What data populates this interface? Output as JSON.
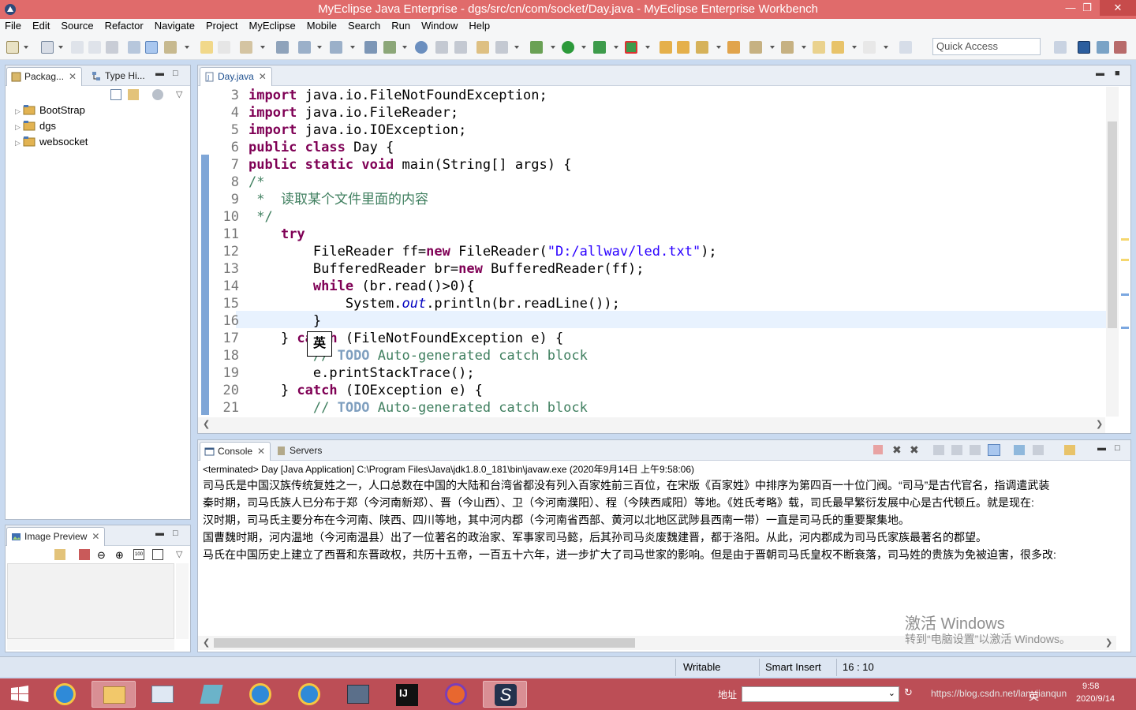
{
  "window": {
    "title": "MyEclipse Java Enterprise - dgs/src/cn/com/socket/Day.java - MyEclipse Enterprise Workbench",
    "min": "—",
    "restore": "❐",
    "close": "✕"
  },
  "menu": [
    "File",
    "Edit",
    "Source",
    "Refactor",
    "Navigate",
    "Project",
    "MyEclipse",
    "Mobile",
    "Search",
    "Run",
    "Window",
    "Help"
  ],
  "quick_access": {
    "placeholder": "Quick Access"
  },
  "explorer": {
    "tabs": [
      "Packag...",
      "Type Hi..."
    ],
    "items": [
      "BootStrap",
      "dgs",
      "websocket"
    ]
  },
  "image_preview": {
    "tab": "Image Preview"
  },
  "editor": {
    "tab": "Day.java",
    "lines": [
      {
        "n": "3",
        "t": [
          [
            "kw",
            "import"
          ],
          [
            "",
            "java.io.FileNotFoundException;"
          ]
        ]
      },
      {
        "n": "4",
        "t": [
          [
            "kw",
            "import"
          ],
          [
            "",
            "java.io.FileReader;"
          ]
        ]
      },
      {
        "n": "5",
        "t": [
          [
            "kw",
            "import"
          ],
          [
            "",
            "java.io.IOException;"
          ]
        ]
      },
      {
        "n": "6",
        "t": [
          [
            "kw",
            "public"
          ],
          [
            "",
            ""
          ],
          [
            "kw",
            "class"
          ],
          [
            "",
            "Day {"
          ]
        ]
      },
      {
        "n": "7",
        "t": [
          [
            "kw",
            "public"
          ],
          [
            "",
            ""
          ],
          [
            "kw",
            "static"
          ],
          [
            "",
            ""
          ],
          [
            "kw",
            "void"
          ],
          [
            "",
            "main(String[] args) {"
          ]
        ]
      },
      {
        "n": "8",
        "t": [
          [
            "cm",
            "/*"
          ]
        ]
      },
      {
        "n": "9",
        "t": [
          [
            "cm",
            " *  读取某个文件里面的内容"
          ]
        ]
      },
      {
        "n": "10",
        "t": [
          [
            "cm",
            " */"
          ]
        ]
      },
      {
        "n": "11",
        "t": [
          [
            "",
            "    "
          ],
          [
            "kw",
            "try"
          ],
          [
            "",
            "",
            " {"
          ]
        ]
      },
      {
        "n": "12",
        "t": [
          [
            "",
            "        FileReader ff="
          ],
          [
            "kw",
            "new"
          ],
          [
            "",
            "FileReader("
          ],
          [
            "str",
            "\"D:/allwav/led.txt\""
          ],
          [
            "",
            ");"
          ]
        ]
      },
      {
        "n": "13",
        "t": [
          [
            "",
            "        BufferedReader br="
          ],
          [
            "kw",
            "new"
          ],
          [
            "",
            "BufferedReader(ff);"
          ]
        ]
      },
      {
        "n": "14",
        "t": [
          [
            "",
            "        "
          ],
          [
            "kw",
            "while"
          ],
          [
            "",
            "(br.read()>0){"
          ]
        ]
      },
      {
        "n": "15",
        "t": [
          [
            "",
            "            System."
          ],
          [
            "fld",
            "out"
          ],
          [
            "",
            ".println(br.readLine());"
          ]
        ]
      },
      {
        "n": "16",
        "t": [
          [
            "",
            "        }"
          ]
        ]
      },
      {
        "n": "17",
        "t": [
          [
            "",
            "    } "
          ],
          [
            "kw",
            "catch"
          ],
          [
            "",
            "(FileNotFoundException e) {"
          ]
        ]
      },
      {
        "n": "18",
        "t": [
          [
            "cm",
            "        // "
          ],
          [
            "todo",
            "TODO"
          ],
          [
            "cm",
            " Auto-generated catch block"
          ]
        ]
      },
      {
        "n": "19",
        "t": [
          [
            "",
            "        e.printStackTrace();"
          ]
        ]
      },
      {
        "n": "20",
        "t": [
          [
            "",
            "    } "
          ],
          [
            "kw",
            "catch"
          ],
          [
            "",
            "(IOException e) {"
          ]
        ]
      },
      {
        "n": "21",
        "t": [
          [
            "cm",
            "        // "
          ],
          [
            "todo",
            "TODO"
          ],
          [
            "cm",
            " Auto-generated catch block"
          ]
        ]
      }
    ],
    "ime": "英"
  },
  "console": {
    "tabs": [
      "Console",
      "Servers"
    ],
    "header": "<terminated> Day [Java Application] C:\\Program Files\\Java\\jdk1.8.0_181\\bin\\javaw.exe (2020年9月14日 上午9:58:06)",
    "lines": [
      "司马氏是中国汉族传统复姓之一，人口总数在中国的大陆和台湾省都没有列入百家姓前三百位，在宋版《百家姓》中排序为第四百一十位门阀。“司马”是古代官名，指调遣武装",
      "秦时期，司马氏族人已分布于郑（今河南新郑）、晋（今山西）、卫（今河南濮阳）、程（今陕西咸阳）等地。《姓氏考略》载，司氏最早繁衍发展中心是古代顿丘。就是现在:",
      "汉时期，司马氏主要分布在今河南、陕西、四川等地，其中河内郡（今河南省西部、黄河以北地区武陟县西南一带）一直是司马氏的重要聚集地。",
      "国曹魏时期，河内温地（今河南温县）出了一位著名的政治家、军事家司马懿，后其孙司马炎废魏建晋，都于洛阳。从此，河内郡成为司马氏家族最著名的郡望。",
      "马氏在中国历史上建立了西晋和东晋政权，共历十五帝，一百五十六年，进一步扩大了司马世家的影响。但是由于晋朝司马氏皇权不断衰落，司马姓的贵族为免被迫害，很多改:"
    ],
    "watermark1": "激活 Windows",
    "watermark2": "转到“电脑设置”以激活 Windows。"
  },
  "status": {
    "writable": "Writable",
    "insert": "Smart Insert",
    "pos": "16 : 10"
  },
  "taskbar": {
    "address_label": "地址",
    "clock_time": "9:58",
    "clock_date": "2020/9/14",
    "tray_text": "https://blog.csdn.net/lan_jianqun",
    "ime": "英"
  }
}
